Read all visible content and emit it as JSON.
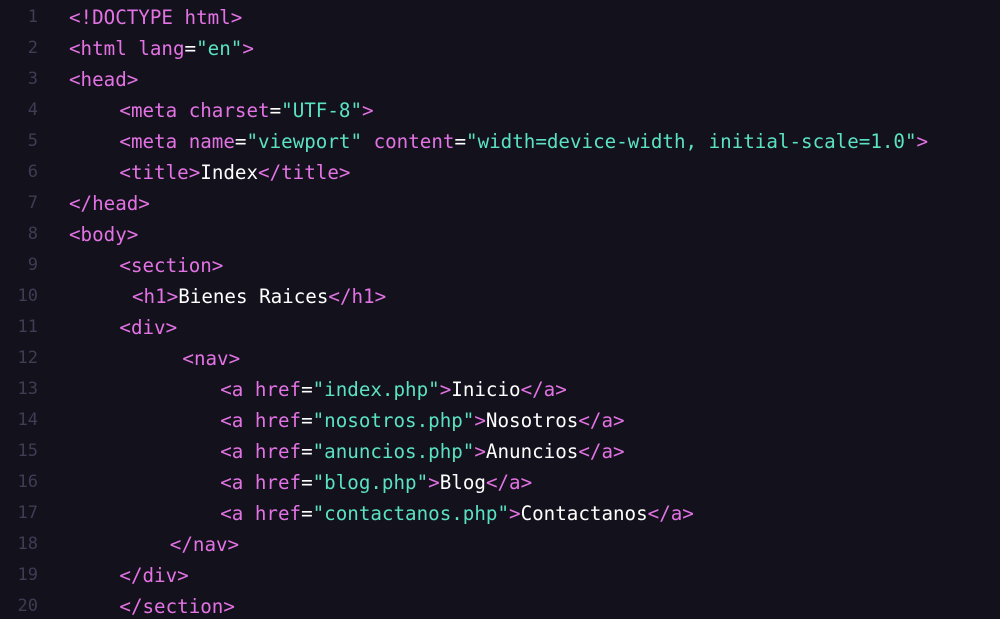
{
  "editor": {
    "colors": {
      "background": "#13111c",
      "line_number": "#3f3c53",
      "tag": "#e373e4",
      "string": "#5ae2c1",
      "text": "#ffffff"
    },
    "lines": [
      {
        "n": "1",
        "indent": 0,
        "tokens": [
          {
            "t": "tag",
            "v": "<!DOCTYPE html>"
          }
        ]
      },
      {
        "n": "2",
        "indent": 0,
        "tokens": [
          {
            "t": "tag",
            "v": "<html "
          },
          {
            "t": "attr",
            "v": "lang"
          },
          {
            "t": "eq",
            "v": "="
          },
          {
            "t": "str",
            "v": "\"en\""
          },
          {
            "t": "tag",
            "v": ">"
          }
        ]
      },
      {
        "n": "3",
        "indent": 0,
        "tokens": [
          {
            "t": "tag",
            "v": "<head>"
          }
        ]
      },
      {
        "n": "4",
        "indent": 4,
        "tokens": [
          {
            "t": "tag",
            "v": "<meta "
          },
          {
            "t": "attr",
            "v": "charset"
          },
          {
            "t": "eq",
            "v": "="
          },
          {
            "t": "str",
            "v": "\"UTF-8\""
          },
          {
            "t": "tag",
            "v": ">"
          }
        ]
      },
      {
        "n": "5",
        "indent": 4,
        "tokens": [
          {
            "t": "tag",
            "v": "<meta "
          },
          {
            "t": "attr",
            "v": "name"
          },
          {
            "t": "eq",
            "v": "="
          },
          {
            "t": "str",
            "v": "\"viewport\""
          },
          {
            "t": "tag",
            "v": " "
          },
          {
            "t": "attr",
            "v": "content"
          },
          {
            "t": "eq",
            "v": "="
          },
          {
            "t": "str",
            "v": "\"width=device-width, initial-scale=1.0\""
          },
          {
            "t": "tag",
            "v": ">"
          }
        ]
      },
      {
        "n": "6",
        "indent": 4,
        "tokens": [
          {
            "t": "tag",
            "v": "<title>"
          },
          {
            "t": "txt",
            "v": "Index"
          },
          {
            "t": "tag",
            "v": "</title>"
          }
        ]
      },
      {
        "n": "7",
        "indent": 0,
        "tokens": [
          {
            "t": "tag",
            "v": "</head>"
          }
        ]
      },
      {
        "n": "8",
        "indent": 0,
        "tokens": [
          {
            "t": "tag",
            "v": "<body>"
          }
        ]
      },
      {
        "n": "9",
        "indent": 4,
        "tokens": [
          {
            "t": "tag",
            "v": "<section>"
          }
        ]
      },
      {
        "n": "10",
        "indent": 5,
        "tokens": [
          {
            "t": "tag",
            "v": "<h1>"
          },
          {
            "t": "txt",
            "v": "Bienes Raices"
          },
          {
            "t": "tag",
            "v": "</h1>"
          }
        ]
      },
      {
        "n": "11",
        "indent": 4,
        "tokens": [
          {
            "t": "tag",
            "v": "<div>"
          }
        ]
      },
      {
        "n": "12",
        "indent": 9,
        "tokens": [
          {
            "t": "tag",
            "v": "<nav>"
          }
        ]
      },
      {
        "n": "13",
        "indent": 12,
        "tokens": [
          {
            "t": "tag",
            "v": "<a "
          },
          {
            "t": "attr",
            "v": "href"
          },
          {
            "t": "eq",
            "v": "="
          },
          {
            "t": "str",
            "v": "\"index.php\""
          },
          {
            "t": "tag",
            "v": ">"
          },
          {
            "t": "txt",
            "v": "Inicio"
          },
          {
            "t": "tag",
            "v": "</a>"
          }
        ]
      },
      {
        "n": "14",
        "indent": 12,
        "tokens": [
          {
            "t": "tag",
            "v": "<a "
          },
          {
            "t": "attr",
            "v": "href"
          },
          {
            "t": "eq",
            "v": "="
          },
          {
            "t": "str",
            "v": "\"nosotros.php\""
          },
          {
            "t": "tag",
            "v": ">"
          },
          {
            "t": "txt",
            "v": "Nosotros"
          },
          {
            "t": "tag",
            "v": "</a>"
          }
        ]
      },
      {
        "n": "15",
        "indent": 12,
        "tokens": [
          {
            "t": "tag",
            "v": "<a "
          },
          {
            "t": "attr",
            "v": "href"
          },
          {
            "t": "eq",
            "v": "="
          },
          {
            "t": "str",
            "v": "\"anuncios.php\""
          },
          {
            "t": "tag",
            "v": ">"
          },
          {
            "t": "txt",
            "v": "Anuncios"
          },
          {
            "t": "tag",
            "v": "</a>"
          }
        ]
      },
      {
        "n": "16",
        "indent": 12,
        "tokens": [
          {
            "t": "tag",
            "v": "<a "
          },
          {
            "t": "attr",
            "v": "href"
          },
          {
            "t": "eq",
            "v": "="
          },
          {
            "t": "str",
            "v": "\"blog.php\""
          },
          {
            "t": "tag",
            "v": ">"
          },
          {
            "t": "txt",
            "v": "Blog"
          },
          {
            "t": "tag",
            "v": "</a>"
          }
        ]
      },
      {
        "n": "17",
        "indent": 12,
        "tokens": [
          {
            "t": "tag",
            "v": "<a "
          },
          {
            "t": "attr",
            "v": "href"
          },
          {
            "t": "eq",
            "v": "="
          },
          {
            "t": "str",
            "v": "\"contactanos.php\""
          },
          {
            "t": "tag",
            "v": ">"
          },
          {
            "t": "txt",
            "v": "Contactanos"
          },
          {
            "t": "tag",
            "v": "</a>"
          }
        ]
      },
      {
        "n": "18",
        "indent": 8,
        "tokens": [
          {
            "t": "tag",
            "v": "</nav>"
          }
        ]
      },
      {
        "n": "19",
        "indent": 4,
        "tokens": [
          {
            "t": "tag",
            "v": "</div>"
          }
        ]
      },
      {
        "n": "20",
        "indent": 4,
        "tokens": [
          {
            "t": "tag",
            "v": "</section>"
          }
        ]
      }
    ]
  }
}
